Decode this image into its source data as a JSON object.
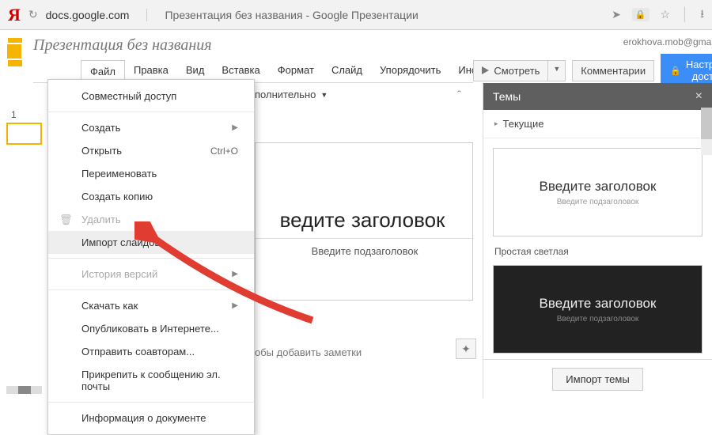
{
  "browser": {
    "provider_glyph": "Я",
    "url_domain": "docs.google.com",
    "page_title": "Презентация без названия - Google Презентации"
  },
  "header": {
    "doc_title": "Презентация без названия",
    "user_email": "erokhova.mob@gmail.com",
    "watch_label": "Смотреть",
    "comments_label": "Комментарии",
    "share_label": "Настройки доступа"
  },
  "menubar": {
    "file": "Файл",
    "edit": "Правка",
    "view": "Вид",
    "insert": "Вставка",
    "format": "Формат",
    "slide": "Слайд",
    "arrange": "Упорядочить",
    "tools_cut": "Инст"
  },
  "toolbar_fragment": "полнительно",
  "file_menu": {
    "share": "Совместный доступ",
    "create": "Создать",
    "open": "Открыть",
    "open_shortcut": "Ctrl+O",
    "rename": "Переименовать",
    "make_copy": "Создать копию",
    "delete": "Удалить",
    "import_slides": "Импорт слайдов...",
    "version_history": "История версий",
    "download_as": "Скачать как",
    "publish": "Опубликовать в Интернете...",
    "email_collab": "Отправить соавторам...",
    "attach_email": "Прикрепить к сообщению эл. почты",
    "doc_info": "Информация о документе"
  },
  "slide_panel": {
    "thumb_number": "1"
  },
  "canvas": {
    "title_placeholder": "ведите заголовок",
    "subtitle_placeholder": "Введите подзаголовок",
    "notes_fragment": "обы добавить заметки"
  },
  "themes_panel": {
    "header": "Темы",
    "current": "Текущие",
    "sample_title": "Введите заголовок",
    "sample_sub": "Введите подзаголовок",
    "theme1_name": "Простая светлая",
    "import_btn": "Импорт темы"
  }
}
